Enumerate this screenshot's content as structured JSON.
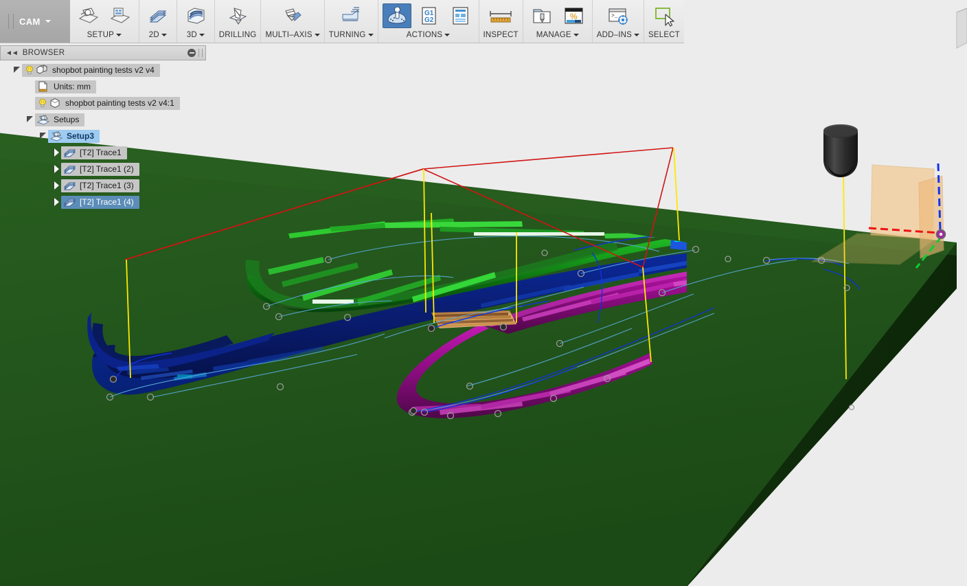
{
  "app": {
    "tab_label": "CAM",
    "tab_icon": "chevron-down-icon"
  },
  "ribbon": {
    "groups": [
      {
        "label": "SETUP",
        "has_caret": true,
        "icons": [
          "setup-new-icon",
          "setup-from-sketch-icon"
        ]
      },
      {
        "label": "2D",
        "has_caret": true,
        "icons": [
          "toolpath-2d-icon"
        ]
      },
      {
        "label": "3D",
        "has_caret": true,
        "icons": [
          "toolpath-3d-icon"
        ]
      },
      {
        "label": "DRILLING",
        "has_caret": false,
        "icons": [
          "drilling-icon"
        ]
      },
      {
        "label": "MULTI–AXIS",
        "has_caret": true,
        "icons": [
          "multi-axis-icon"
        ]
      },
      {
        "label": "TURNING",
        "has_caret": true,
        "icons": [
          "turning-icon"
        ]
      },
      {
        "label": "ACTIONS",
        "has_caret": true,
        "icons": [
          "simulate-icon",
          "post-process-g1g2-icon",
          "setup-sheet-icon"
        ],
        "active_icon_index": 0
      },
      {
        "label": "INSPECT",
        "has_caret": false,
        "icons": [
          "measure-ruler-icon"
        ]
      },
      {
        "label": "MANAGE",
        "has_caret": true,
        "icons": [
          "tool-library-icon",
          "machining-time-percent-icon"
        ]
      },
      {
        "label": "ADD–INS",
        "has_caret": true,
        "icons": [
          "scripts-addins-icon"
        ]
      },
      {
        "label": "SELECT",
        "has_caret": false,
        "icons": [
          "select-window-cursor-icon"
        ]
      }
    ]
  },
  "browser": {
    "title": "BROWSER",
    "collapse_icon": "double-chevron-left-icon",
    "minimize_icon": "minus-circle-icon",
    "tree": [
      {
        "label": "shopbot painting tests v2 v4",
        "indent": 0,
        "twisty": "open",
        "lightbulb": true,
        "icon": "document-body-icon",
        "state": "normal"
      },
      {
        "label": "Units: mm",
        "indent": 1,
        "twisty": "none",
        "lightbulb": false,
        "icon": "units-document-icon",
        "state": "normal"
      },
      {
        "label": "shopbot painting tests v2 v4:1",
        "indent": 1,
        "twisty": "none",
        "lightbulb": true,
        "icon": "component-cube-icon",
        "state": "normal"
      },
      {
        "label": "Setups",
        "indent": 1,
        "twisty": "open",
        "lightbulb": false,
        "icon": "setup-folder-icon",
        "state": "normal"
      },
      {
        "label": "Setup3",
        "indent": 2,
        "twisty": "open",
        "lightbulb": false,
        "icon": "setup-folder-icon",
        "state": "setup-selected"
      },
      {
        "label": "[T2] Trace1",
        "indent": 3,
        "twisty": "closed",
        "lightbulb": false,
        "icon": "toolpath-trace-icon",
        "state": "normal"
      },
      {
        "label": "[T2] Trace1 (2)",
        "indent": 3,
        "twisty": "closed",
        "lightbulb": false,
        "icon": "toolpath-trace-icon",
        "state": "normal"
      },
      {
        "label": "[T2] Trace1 (3)",
        "indent": 3,
        "twisty": "closed",
        "lightbulb": false,
        "icon": "toolpath-trace-icon",
        "state": "normal"
      },
      {
        "label": "[T2] Trace1 (4)",
        "indent": 3,
        "twisty": "closed",
        "lightbulb": false,
        "icon": "toolpath-trace-icon",
        "state": "selected"
      }
    ]
  },
  "viewport": {
    "background_color": "#ececec",
    "stock_top_color": "#22551b",
    "stock_side_color": "#10300b",
    "toolpaths": [
      {
        "name": "trace-green",
        "color": "#1faa20"
      },
      {
        "name": "trace-blue",
        "color": "#0a1f7a"
      },
      {
        "name": "trace-magenta",
        "color": "#9c0f8f"
      },
      {
        "name": "trace-orange-highlight",
        "color": "#d79a56"
      }
    ],
    "rapid_move_color": "#ffe800",
    "lead_move_color": "#cc1111",
    "link_move_color": "#3f9fd0",
    "tool_color": "#2a2a2a",
    "wcs_plane_color": "#f5c584",
    "axis_x_color": "#ee1111",
    "axis_y_color": "#11cc33",
    "axis_z_color": "#1133ee",
    "origin_marker_color": "#b030b0",
    "tool_name": "flat-end-mill-tool",
    "viewcube_label": "view-cube"
  }
}
